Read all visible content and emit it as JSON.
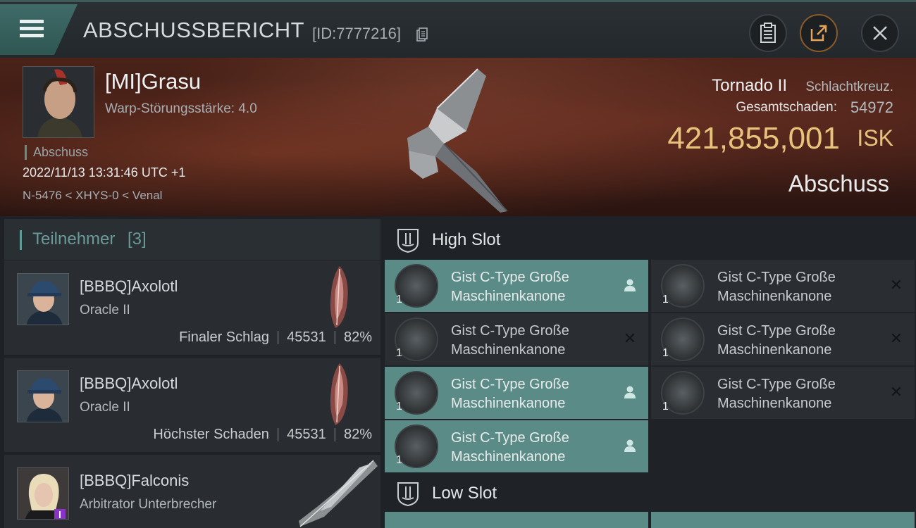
{
  "header": {
    "title": "ABSCHUSSBERICHT",
    "id_label": "[ID:7777216]"
  },
  "victim": {
    "name": "[MI]Grasu",
    "warp_strength": "Warp-Störungsstärke: 4.0",
    "kill_tag": "Abschuss",
    "datetime": "2022/11/13 13:31:46 UTC +1",
    "location": "N-5476 < XHYS-0 < Venal",
    "ship_name": "Tornado II",
    "ship_class": "Schlachtkreuz.",
    "damage_label": "Gesamtschaden:",
    "damage_value": "54972",
    "isk_value": "421,855,001",
    "isk_unit": "ISK",
    "result": "Abschuss"
  },
  "participants": {
    "title": "Teilnehmer",
    "count": "[3]",
    "items": [
      {
        "name": "[BBBQ]Axolotl",
        "ship": "Oracle II",
        "role": "Finaler Schlag",
        "damage": "45531",
        "percent": "82%"
      },
      {
        "name": "[BBBQ]Axolotl",
        "ship": "Oracle II",
        "role": "Höchster Schaden",
        "damage": "45531",
        "percent": "82%"
      },
      {
        "name": "[BBBQ]Falconis",
        "ship": "Arbitrator Unterbrecher",
        "role": "",
        "damage": "",
        "percent": ""
      }
    ]
  },
  "slots": {
    "high_label": "High Slot",
    "low_label": "Low Slot",
    "modules": [
      {
        "line1": "Gist C-Type Große",
        "line2": "Maschinenkanone",
        "qty": "1",
        "status": "dropped"
      },
      {
        "line1": "Gist C-Type Große",
        "line2": "Maschinenkanone",
        "qty": "1",
        "status": "destroyed"
      },
      {
        "line1": "Gist C-Type Große",
        "line2": "Maschinenkanone",
        "qty": "1",
        "status": "destroyed"
      },
      {
        "line1": "Gist C-Type Große",
        "line2": "Maschinenkanone",
        "qty": "1",
        "status": "destroyed"
      },
      {
        "line1": "Gist C-Type Große",
        "line2": "Maschinenkanone",
        "qty": "1",
        "status": "dropped"
      },
      {
        "line1": "Gist C-Type Große",
        "line2": "Maschinenkanone",
        "qty": "1",
        "status": "destroyed"
      },
      {
        "line1": "Gist C-Type Große",
        "line2": "Maschinenkanone",
        "qty": "1",
        "status": "dropped"
      }
    ]
  },
  "colors": {
    "accent_teal": "#5b8b86",
    "isk_gold": "#e7c27a"
  }
}
